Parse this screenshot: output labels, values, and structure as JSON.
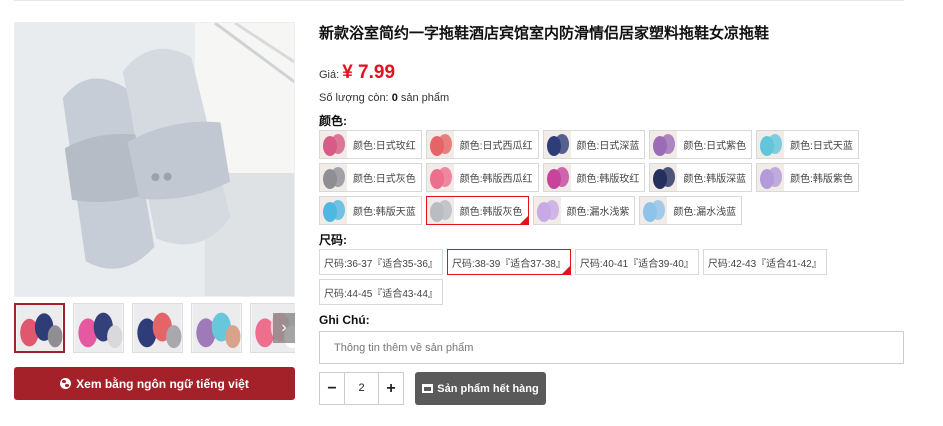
{
  "product": {
    "title": "新款浴室简约一字拖鞋酒店宾馆室内防滑情侣居家塑料拖鞋女凉拖鞋",
    "price_label": "Giá:",
    "price": "¥ 7.99",
    "stock_prefix": "Số lượng còn:",
    "stock_value": "0",
    "stock_suffix": "sản phẩm"
  },
  "colors": {
    "label": "颜色:",
    "options": [
      {
        "label": "颜色:日式玫红",
        "swatch": "#d85a86",
        "selected": false
      },
      {
        "label": "颜色:日式西瓜红",
        "swatch": "#e56467",
        "selected": false
      },
      {
        "label": "颜色:日式深蓝",
        "swatch": "#2e3d78",
        "selected": false
      },
      {
        "label": "颜色:日式紫色",
        "swatch": "#9c6bb5",
        "selected": false
      },
      {
        "label": "颜色:日式天蓝",
        "swatch": "#62c5dc",
        "selected": false
      },
      {
        "label": "颜色:日式灰色",
        "swatch": "#8f8f93",
        "selected": false
      },
      {
        "label": "颜色:韩版西瓜红",
        "swatch": "#ee6f8d",
        "selected": false
      },
      {
        "label": "颜色:韩版玫红",
        "swatch": "#c7449c",
        "selected": false
      },
      {
        "label": "颜色:韩版深蓝",
        "swatch": "#25305e",
        "selected": false
      },
      {
        "label": "颜色:韩版紫色",
        "swatch": "#b39ad8",
        "selected": false
      },
      {
        "label": "颜色:韩版天蓝",
        "swatch": "#4fb8e2",
        "selected": false
      },
      {
        "label": "颜色:韩版灰色",
        "swatch": "#b9bcc0",
        "selected": true
      },
      {
        "label": "颜色:漏水浅紫",
        "swatch": "#c9a8e6",
        "selected": false
      },
      {
        "label": "颜色:漏水浅蓝",
        "swatch": "#8ec3ea",
        "selected": false
      }
    ]
  },
  "sizes": {
    "label": "尺码:",
    "options": [
      {
        "label": "尺码:36-37『适合35-36』",
        "selected": false
      },
      {
        "label": "尺码:38-39『适合37-38』",
        "selected": true
      },
      {
        "label": "尺码:40-41『适合39-40』",
        "selected": false
      },
      {
        "label": "尺码:42-43『适合41-42』",
        "selected": false
      },
      {
        "label": "尺码:44-45『适合43-44』",
        "selected": false
      }
    ]
  },
  "note": {
    "label": "Ghi Chú:",
    "placeholder": "Thông tin thêm về sản phẩm"
  },
  "quantity": {
    "minus": "−",
    "value": "2",
    "plus": "+"
  },
  "actions": {
    "soldout_label": "Sản phẩm hết hàng",
    "translate_label": "Xem bằng ngôn ngữ tiếng việt"
  },
  "gallery": {
    "next_arrow": "›",
    "thumbs": [
      {
        "colors": [
          "#e0576e",
          "#2e3d78",
          "#8f8f93"
        ],
        "active": true
      },
      {
        "colors": [
          "#e659a0",
          "#33407a",
          "#d9d9dc"
        ],
        "active": false
      },
      {
        "colors": [
          "#2e3d78",
          "#e56467",
          "#a9a9ad"
        ],
        "active": false
      },
      {
        "colors": [
          "#9e7bb8",
          "#67c7db",
          "#d9a28a"
        ],
        "active": false
      },
      {
        "colors": [
          "#ee6f8d",
          "#f6cdd6",
          "#ffffff"
        ],
        "active": false
      }
    ],
    "main_color": "#d8dde2"
  }
}
